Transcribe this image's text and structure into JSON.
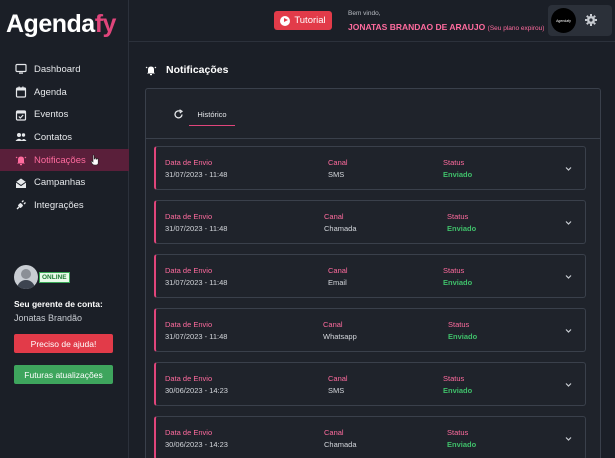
{
  "app": {
    "logo_main": "Agenda",
    "logo_accent": "fy"
  },
  "sidebar": {
    "items": [
      {
        "label": "Dashboard",
        "icon": "monitor-icon"
      },
      {
        "label": "Agenda",
        "icon": "calendar-icon"
      },
      {
        "label": "Eventos",
        "icon": "calendar-check-icon"
      },
      {
        "label": "Contatos",
        "icon": "users-icon"
      },
      {
        "label": "Notificações",
        "icon": "bell-alert-icon",
        "active": true
      },
      {
        "label": "Campanhas",
        "icon": "envelope-open-icon"
      },
      {
        "label": "Integrações",
        "icon": "plug-icon"
      }
    ],
    "manager": {
      "status": "ONLINE",
      "title": "Seu gerente de conta:",
      "name": "Jonatas Brandão"
    },
    "help_button": "Preciso de ajuda!",
    "updates_button": "Futuras atualizações"
  },
  "header": {
    "tutorial_label": "Tutorial",
    "welcome": "Bem vindo,",
    "user_name": "JONATAS BRANDAO DE ARAUJO",
    "plan_note": "(Seu plano expirou)",
    "brand_logo_text": "Agendafy"
  },
  "main": {
    "title": "Notificações",
    "tab_label": "Histórico",
    "field_labels": {
      "date": "Data de Envio",
      "channel": "Canal",
      "status": "Status"
    },
    "notifications": [
      {
        "date": "31/07/2023 - 11:48",
        "channel": "SMS",
        "status": "Enviado"
      },
      {
        "date": "31/07/2023 - 11:48",
        "channel": "Chamada",
        "status": "Enviado"
      },
      {
        "date": "31/07/2023 - 11:48",
        "channel": "Email",
        "status": "Enviado"
      },
      {
        "date": "31/07/2023 - 11:48",
        "channel": "Whatsapp",
        "status": "Enviado"
      },
      {
        "date": "30/06/2023 - 14:23",
        "channel": "SMS",
        "status": "Enviado"
      },
      {
        "date": "30/06/2023 - 14:23",
        "channel": "Chamada",
        "status": "Enviado"
      }
    ]
  },
  "colors": {
    "accent": "#e0457b",
    "success": "#3fbf6a",
    "danger": "#e23b49",
    "background": "#1b1f27"
  }
}
